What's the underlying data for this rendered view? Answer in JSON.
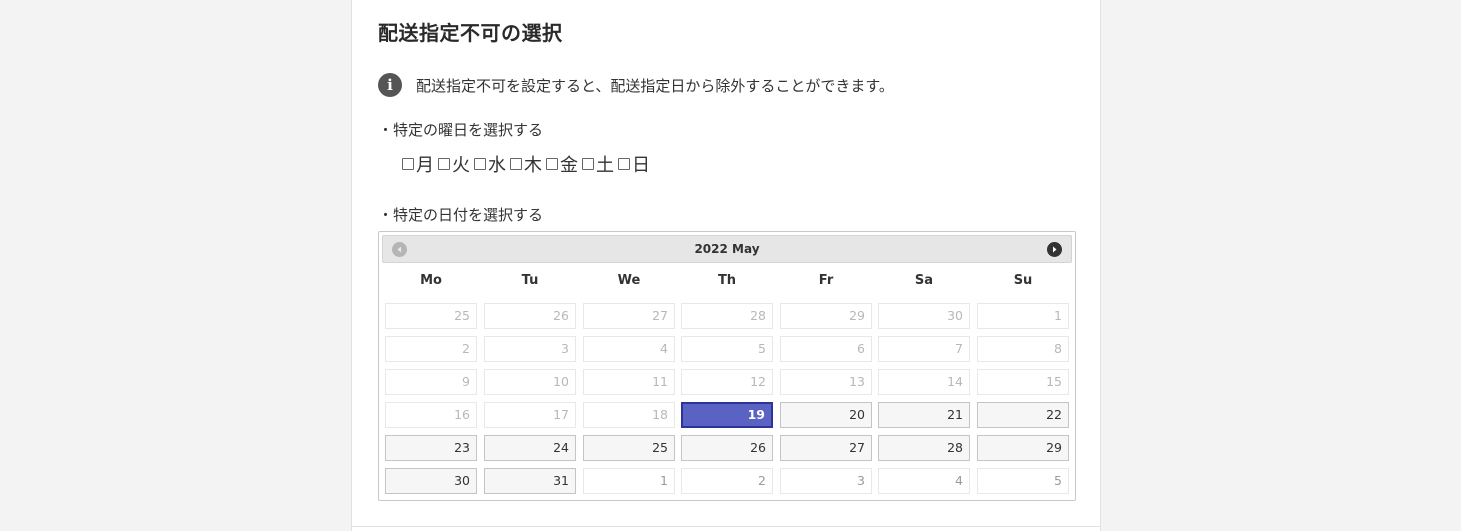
{
  "title": "配送指定不可の選択",
  "info": {
    "icon": "info-icon",
    "glyph": "i",
    "text": "配送指定不可を設定すると、配送指定日から除外することができます。"
  },
  "weekday_section": {
    "label": "・特定の曜日を選択する",
    "days": [
      {
        "label": "月",
        "checked": false
      },
      {
        "label": "火",
        "checked": false
      },
      {
        "label": "水",
        "checked": false
      },
      {
        "label": "木",
        "checked": false
      },
      {
        "label": "金",
        "checked": false
      },
      {
        "label": "土",
        "checked": false
      },
      {
        "label": "日",
        "checked": false
      }
    ]
  },
  "date_section": {
    "label": "・特定の日付を選択する"
  },
  "calendar": {
    "title": "2022 May",
    "prev_icon": "prev-month-icon",
    "next_icon": "next-month-icon",
    "day_names": [
      "Mo",
      "Tu",
      "We",
      "Th",
      "Fr",
      "Sa",
      "Su"
    ],
    "colors": {
      "selected": "#5a62c4",
      "selected_border": "#2c3399"
    },
    "weeks": [
      [
        {
          "d": "25",
          "state": "disabled"
        },
        {
          "d": "26",
          "state": "disabled"
        },
        {
          "d": "27",
          "state": "disabled"
        },
        {
          "d": "28",
          "state": "disabled"
        },
        {
          "d": "29",
          "state": "disabled"
        },
        {
          "d": "30",
          "state": "disabled"
        },
        {
          "d": "1",
          "state": "disabled"
        }
      ],
      [
        {
          "d": "2",
          "state": "disabled"
        },
        {
          "d": "3",
          "state": "disabled"
        },
        {
          "d": "4",
          "state": "disabled"
        },
        {
          "d": "5",
          "state": "disabled"
        },
        {
          "d": "6",
          "state": "disabled"
        },
        {
          "d": "7",
          "state": "disabled"
        },
        {
          "d": "8",
          "state": "disabled"
        }
      ],
      [
        {
          "d": "9",
          "state": "disabled"
        },
        {
          "d": "10",
          "state": "disabled"
        },
        {
          "d": "11",
          "state": "disabled"
        },
        {
          "d": "12",
          "state": "disabled"
        },
        {
          "d": "13",
          "state": "disabled"
        },
        {
          "d": "14",
          "state": "disabled"
        },
        {
          "d": "15",
          "state": "disabled"
        }
      ],
      [
        {
          "d": "16",
          "state": "disabled"
        },
        {
          "d": "17",
          "state": "disabled"
        },
        {
          "d": "18",
          "state": "disabled"
        },
        {
          "d": "19",
          "state": "selected"
        },
        {
          "d": "20",
          "state": "active"
        },
        {
          "d": "21",
          "state": "active"
        },
        {
          "d": "22",
          "state": "active"
        }
      ],
      [
        {
          "d": "23",
          "state": "active"
        },
        {
          "d": "24",
          "state": "active"
        },
        {
          "d": "25",
          "state": "active"
        },
        {
          "d": "26",
          "state": "active"
        },
        {
          "d": "27",
          "state": "active"
        },
        {
          "d": "28",
          "state": "active"
        },
        {
          "d": "29",
          "state": "active"
        }
      ],
      [
        {
          "d": "30",
          "state": "active"
        },
        {
          "d": "31",
          "state": "active"
        },
        {
          "d": "1",
          "state": "other"
        },
        {
          "d": "2",
          "state": "other"
        },
        {
          "d": "3",
          "state": "other"
        },
        {
          "d": "4",
          "state": "other"
        },
        {
          "d": "5",
          "state": "other"
        }
      ]
    ]
  }
}
